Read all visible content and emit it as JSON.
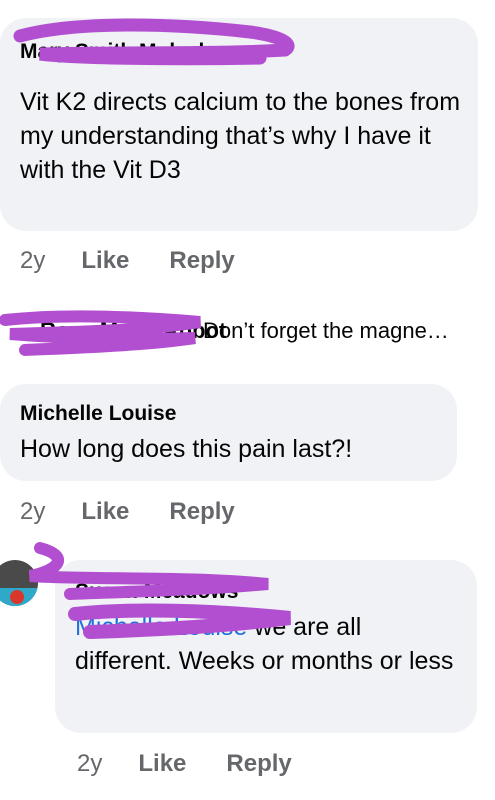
{
  "comment1": {
    "author": "Mary Smith Mulcahy",
    "text": "Vit K2 directs calcium to the bones from my understanding that’s why I have it with the Vit D3",
    "time": "2y",
    "like": "Like",
    "reply": "Reply"
  },
  "collapsed_reply": {
    "author": "Rose Marie Abbot",
    "text": "Don’t forget the magne…"
  },
  "comment2": {
    "author": "Michelle Louise",
    "text": "How long does this pain last?!",
    "time": "2y",
    "like": "Like",
    "reply": "Reply"
  },
  "comment3": {
    "author": "Susan Meadows",
    "mention": "Michelle Louise",
    "text": "we are all different. Weeks or months or less",
    "time": "2y",
    "like": "Like",
    "reply": "Reply"
  },
  "colors": {
    "bubble": "#f0f2f5",
    "meta": "#65676b",
    "mention": "#216fdb",
    "redaction": "#b24fd0"
  }
}
